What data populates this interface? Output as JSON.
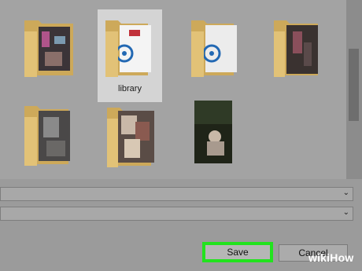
{
  "files": [
    {
      "label": ""
    },
    {
      "label": "library"
    },
    {
      "label": ""
    },
    {
      "label": ""
    },
    {
      "label": ""
    },
    {
      "label": ""
    },
    {
      "label": ""
    }
  ],
  "fields": {
    "chevron": "⌄"
  },
  "buttons": {
    "save_label": "Save",
    "cancel_label": "Cancel"
  },
  "watermark": {
    "brand": "wikiHow"
  },
  "colors": {
    "save_highlight": "#22e31e",
    "folder": "#e2c277"
  }
}
